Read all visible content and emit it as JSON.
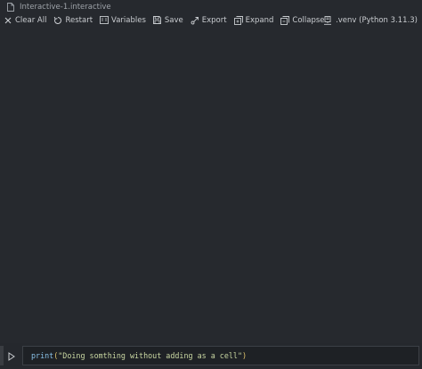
{
  "window": {
    "tab_title": "Interactive-1.interactive"
  },
  "toolbar": {
    "items": [
      {
        "label": "Clear All",
        "icon": "close-icon"
      },
      {
        "label": "Restart",
        "icon": "restart-icon"
      },
      {
        "label": "Variables",
        "icon": "variables-icon"
      },
      {
        "label": "Save",
        "icon": "save-icon"
      },
      {
        "label": "Export",
        "icon": "export-icon"
      },
      {
        "label": "Expand",
        "icon": "expand-icon"
      },
      {
        "label": "Collapse",
        "icon": "collapse-icon"
      }
    ],
    "kernel_label": ".venv (Python 3.11.3)",
    "kernel_icon": "server-environment-icon"
  },
  "input": {
    "code_fn": "print",
    "code_open": "(",
    "code_string": "\"Doing somthing without adding as a cell\"",
    "code_close": ")",
    "run_icon": "run-triangle-icon"
  },
  "colors": {
    "background": "#26292e",
    "editor_background": "#1e2125",
    "function_token": "#89c0e6",
    "paren_token": "#e0c36a",
    "string_token": "#c9d7a2"
  }
}
